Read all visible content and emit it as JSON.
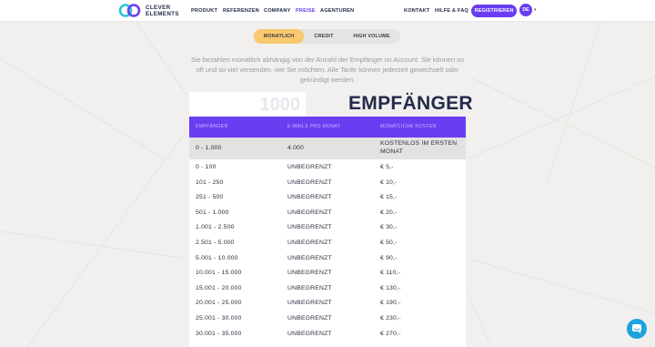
{
  "header": {
    "logo_line1": "CLEVER",
    "logo_line2": "ELEMENTS",
    "nav": [
      "PRODUKT",
      "REFERENZEN",
      "COMPANY",
      "PREISE",
      "AGENTUREN"
    ],
    "nav_active": "PREISE",
    "right_links": [
      "KONTAKT",
      "HILFE & FAQ"
    ],
    "register_label": "REGISTRIEREN",
    "language": "DE"
  },
  "toggle": [
    "MONATLICH",
    "CREDIT",
    "HIGH VOLUME"
  ],
  "toggle_active": "MONATLICH",
  "intro": "Sie bezahlen monatlich abhängig von der Anzahl der Empfänger im Account. Sie können so oft und so viel versenden, wie Sie möchten. Alle Tarife können jederzeit gewechselt oder gekündigt werden.",
  "recipient_input": "1000",
  "recipient_label": "EMPFÄNGER",
  "table": {
    "headers": [
      "EMPFÄNGER",
      "E-MAILS PRO MONAT",
      "MONATLICHE KOSTEN"
    ],
    "rows": [
      [
        "0 - 1.000",
        "4.000",
        "KOSTENLOS IM ERSTEN MONAT"
      ],
      [
        "0 - 100",
        "UNBEGRENZT",
        "€ 5,-"
      ],
      [
        "101 - 250",
        "UNBEGRENZT",
        "€ 10,-"
      ],
      [
        "251 - 500",
        "UNBEGRENZT",
        "€ 15,-"
      ],
      [
        "501 - 1.000",
        "UNBEGRENZT",
        "€ 20,-"
      ],
      [
        "1.001 - 2.500",
        "UNBEGRENZT",
        "€ 30,-"
      ],
      [
        "2.501 - 5.000",
        "UNBEGRENZT",
        "€ 50,-"
      ],
      [
        "5.001 - 10.000",
        "UNBEGRENZT",
        "€ 90,-"
      ],
      [
        "10.001 - 15.000",
        "UNBEGRENZT",
        "€ 110,-"
      ],
      [
        "15.001 - 20.000",
        "UNBEGRENZT",
        "€ 130,-"
      ],
      [
        "20.001 - 25.000",
        "UNBEGRENZT",
        "€ 190,-"
      ],
      [
        "25.001 - 30.000",
        "UNBEGRENZT",
        "€ 230,-"
      ],
      [
        "30.001 - 35.000",
        "UNBEGRENZT",
        "€ 270,-"
      ]
    ]
  },
  "colors": {
    "accent": "#6a3df0",
    "toggle_active": "#f8c96f",
    "chat": "#1ea3dc"
  },
  "icons": [
    "clever-elements-logo-icon",
    "chevron-down-icon",
    "chat-icon"
  ]
}
